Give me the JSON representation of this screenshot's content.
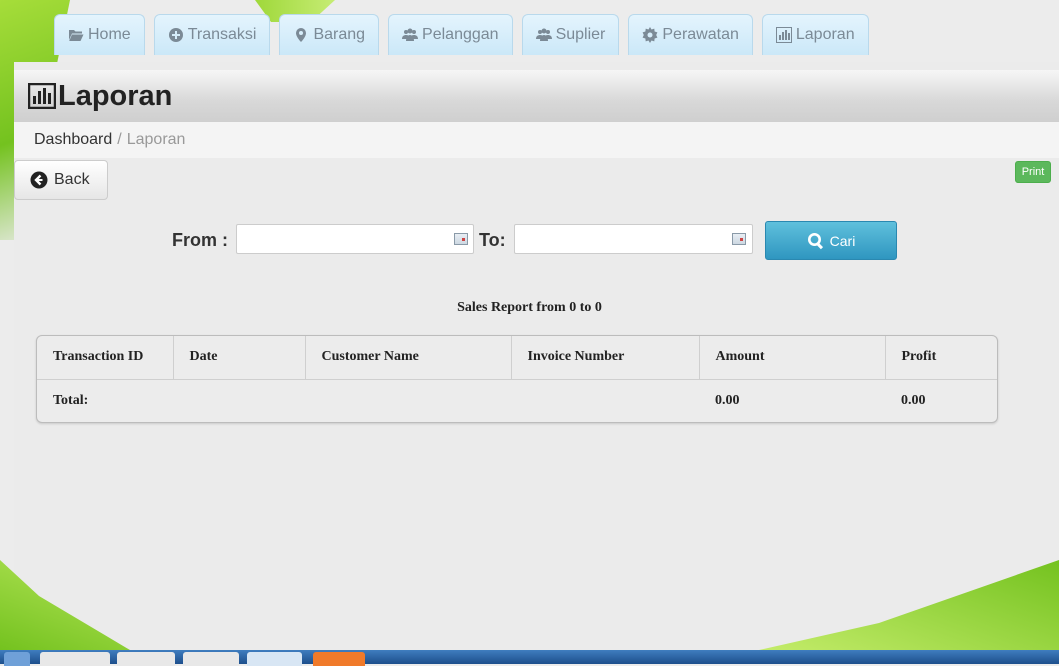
{
  "nav": {
    "items": [
      {
        "label": "Home",
        "icon": "folder-open-icon"
      },
      {
        "label": "Transaksi",
        "icon": "plus-circle-icon"
      },
      {
        "label": "Barang",
        "icon": "map-marker-icon"
      },
      {
        "label": "Pelanggan",
        "icon": "users-icon"
      },
      {
        "label": "Suplier",
        "icon": "users-icon"
      },
      {
        "label": "Perawatan",
        "icon": "cog-icon"
      },
      {
        "label": "Laporan",
        "icon": "bar-chart-icon"
      }
    ]
  },
  "header": {
    "title": "Laporan",
    "icon": "bar-chart-icon"
  },
  "breadcrumb": {
    "root": "Dashboard",
    "separator": "/",
    "current": "Laporan"
  },
  "actions": {
    "back_label": "Back",
    "print_label": "Print",
    "search_label": "Cari"
  },
  "filter": {
    "from_label": "From :",
    "to_label": "To:",
    "from_value": "",
    "to_value": ""
  },
  "report": {
    "title": "Sales Report from 0 to 0"
  },
  "table": {
    "columns": [
      "Transaction ID",
      "Date",
      "Customer Name",
      "Invoice Number",
      "Amount",
      "Profit"
    ],
    "total_label": "Total:",
    "total_amount": "0.00",
    "total_profit": "0.00"
  },
  "colors": {
    "accent": "#5bc0de",
    "print": "#5cb85c",
    "nav_bg": "#d6edfa"
  }
}
